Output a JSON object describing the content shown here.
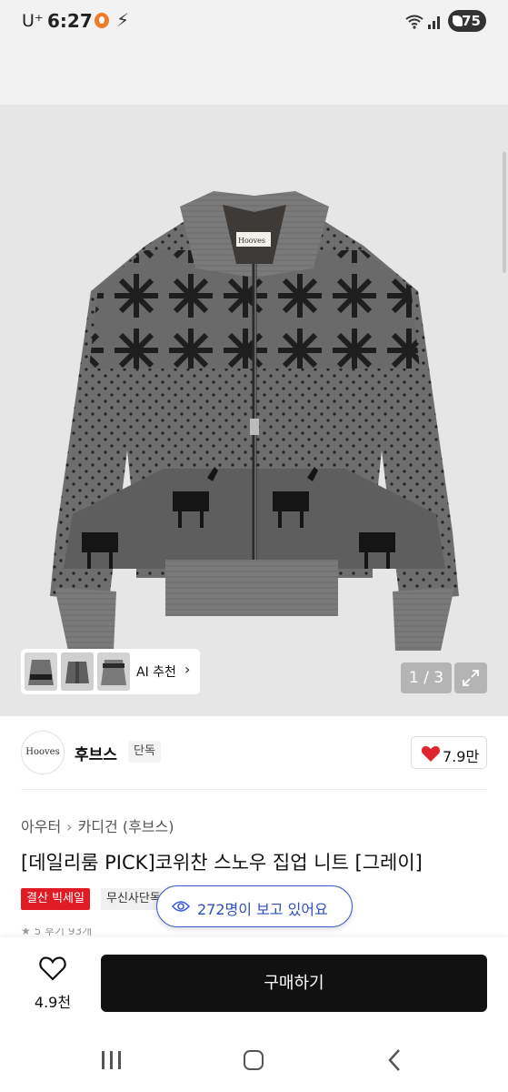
{
  "status_bar": {
    "carrier": "U⁺",
    "time": "6:27",
    "battery": "75",
    "icons": [
      "app-notification-icon",
      "bolt-icon",
      "wifi-icon",
      "signal-icon",
      "battery-icon"
    ]
  },
  "product_image": {
    "garment_label": "Hooves",
    "ai_recommend_label": "AI 추천",
    "counter": "1 / 3"
  },
  "brand": {
    "logo_text": "Hooves",
    "name": "후브스",
    "badge": "단독",
    "like_count": "7.9만"
  },
  "breadcrumb": [
    "아우터",
    "카디건 (후브스)"
  ],
  "product": {
    "title": "[데일리룸 PICK]코위찬 스노우 집업 니트 [그레이]",
    "sale_tag": "결산 빅세일",
    "store_tag": "무신사단독",
    "viewers_text": "272명이 보고 있어요",
    "rating_partial": "★ 5  후기 93개"
  },
  "bottom_bar": {
    "like_count": "4.9천",
    "buy_label": "구매하기"
  },
  "colors": {
    "sale_red": "#e01b24",
    "viewers_blue": "#2f4fbf",
    "buy_black": "#111111",
    "heart_red": "#e0242f"
  }
}
